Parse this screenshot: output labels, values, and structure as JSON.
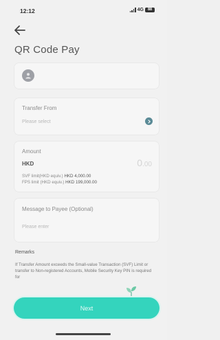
{
  "status_bar": {
    "time": "12:12",
    "network": "4G",
    "battery": "88"
  },
  "page": {
    "title": "QR Code Pay"
  },
  "transfer_from": {
    "label": "Transfer From",
    "placeholder": "Please select"
  },
  "amount": {
    "label": "Amount",
    "currency": "HKD",
    "value_whole": "0",
    "value_cents": ".00",
    "svf_limit_label": "SVF limit(HKD equiv.)",
    "svf_limit_value": "HKD 4,000.00",
    "fps_limit_label": "FPS limit (HKD equiv.)",
    "fps_limit_value": "HKD 199,000.00"
  },
  "message": {
    "label": "Message to Payee (Optional)",
    "placeholder": "Please enter"
  },
  "remarks": {
    "title": "Remarks",
    "text": "If Transfer Amount exceeds the Small-value Transaction (SVF) Limit or transfer to Non-registered Accounts, Mobile Security Key PIN is required for"
  },
  "next_button": {
    "label": "Next"
  },
  "colors": {
    "accent": "#34d4bd",
    "background": "#f1f1f1",
    "chevron": "#5a8a96"
  }
}
